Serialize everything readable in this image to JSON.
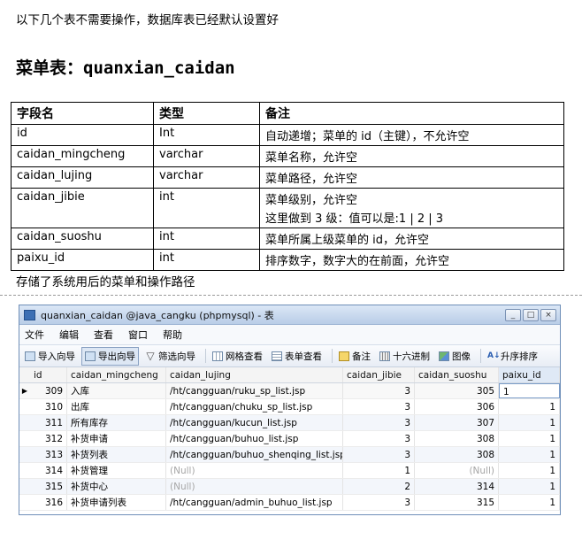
{
  "doc": {
    "intro": "以下几个表不需要操作，数据库表已经默认设置好",
    "heading_prefix": "菜单表：",
    "heading_code": "quanxian_caidan",
    "table_headers": [
      "字段名",
      "类型",
      "备注"
    ],
    "table_rows": [
      {
        "name": "id",
        "type": "Int",
        "note": "自动递增；菜单的 id（主键），不允许空",
        "note2": ""
      },
      {
        "name": "caidan_mingcheng",
        "type": "varchar",
        "note": "菜单名称，允许空",
        "note2": ""
      },
      {
        "name": "caidan_lujing",
        "type": "varchar",
        "note": "菜单路径，允许空",
        "note2": ""
      },
      {
        "name": "caidan_jibie",
        "type": "int",
        "note": "菜单级别，允许空",
        "note2": "这里做到 3 级：值可以是:1  | 2 | 3"
      },
      {
        "name": "caidan_suoshu",
        "type": "int",
        "note": "菜单所属上级菜单的 id，允许空",
        "note2": ""
      },
      {
        "name": "paixu_id",
        "type": "int",
        "note": "排序数字，数字大的在前面，允许空",
        "note2": ""
      }
    ],
    "footnote": "存储了系统用后的菜单和操作路径"
  },
  "window": {
    "title": "quanxian_caidan @java_cangku (phpmysql) - 表",
    "buttons": [
      "_",
      "□",
      "×"
    ],
    "menu": [
      "文件",
      "编辑",
      "查看",
      "窗口",
      "帮助"
    ],
    "toolbar": [
      "导入向导",
      "导出向导",
      "筛选向导",
      "网格查看",
      "表单查看",
      "备注",
      "十六进制",
      "图像",
      "升序排序"
    ],
    "columns": [
      "id",
      "caidan_mingcheng",
      "caidan_lujing",
      "caidan_jibie",
      "caidan_suoshu",
      "paixu_id"
    ],
    "rows": [
      [
        "309",
        "入库",
        "/ht/cangguan/ruku_sp_list.jsp",
        "3",
        "305",
        "1"
      ],
      [
        "310",
        "出库",
        "/ht/cangguan/chuku_sp_list.jsp",
        "3",
        "306",
        "1"
      ],
      [
        "311",
        "所有库存",
        "/ht/cangguan/kucun_list.jsp",
        "3",
        "307",
        "1"
      ],
      [
        "312",
        "补货申请",
        "/ht/cangguan/buhuo_list.jsp",
        "3",
        "308",
        "1"
      ],
      [
        "313",
        "补货列表",
        "/ht/cangguan/buhuo_shenqing_list.jsp",
        "3",
        "308",
        "1"
      ],
      [
        "314",
        "补货管理",
        "(Null)",
        "1",
        "(Null)",
        "1"
      ],
      [
        "315",
        "补货中心",
        "(Null)",
        "2",
        "314",
        "1"
      ],
      [
        "316",
        "补货申请列表",
        "/ht/cangguan/admin_buhuo_list.jsp",
        "3",
        "315",
        "1"
      ]
    ]
  }
}
